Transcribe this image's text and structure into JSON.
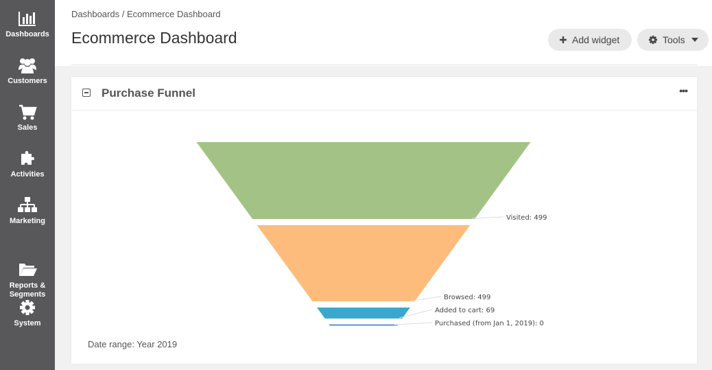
{
  "sidebar": {
    "items": [
      {
        "label": "Dashboards",
        "icon": "bar-chart-icon"
      },
      {
        "label": "Customers",
        "icon": "users-icon"
      },
      {
        "label": "Sales",
        "icon": "cart-icon"
      },
      {
        "label": "Activities",
        "icon": "puzzle-icon"
      },
      {
        "label": "Marketing",
        "icon": "sitemap-icon"
      },
      {
        "label": "Reports &\nSegments",
        "icon": "folder-icon"
      },
      {
        "label": "System",
        "icon": "gear-icon"
      }
    ]
  },
  "header": {
    "breadcrumb": {
      "root": "Dashboards",
      "separator": "/",
      "current": "Ecommerce Dashboard"
    },
    "title": "Ecommerce Dashboard",
    "add_widget_label": "Add widget",
    "tools_label": "Tools"
  },
  "widget": {
    "title": "Purchase Funnel",
    "date_range": "Date range: Year 2019"
  },
  "chart_data": {
    "type": "funnel",
    "categories": [
      "Visited",
      "Browsed",
      "Added to cart",
      "Purchased (from Jan 1, 2019)"
    ],
    "values": [
      499,
      499,
      69,
      0
    ],
    "labels": [
      "Visited: 499",
      "Browsed: 499",
      "Added to cart: 69",
      "Purchased (from Jan 1, 2019): 0"
    ],
    "colors": [
      "#a3c386",
      "#fdbc7c",
      "#3aa8cc",
      "#5b8fd6"
    ]
  }
}
